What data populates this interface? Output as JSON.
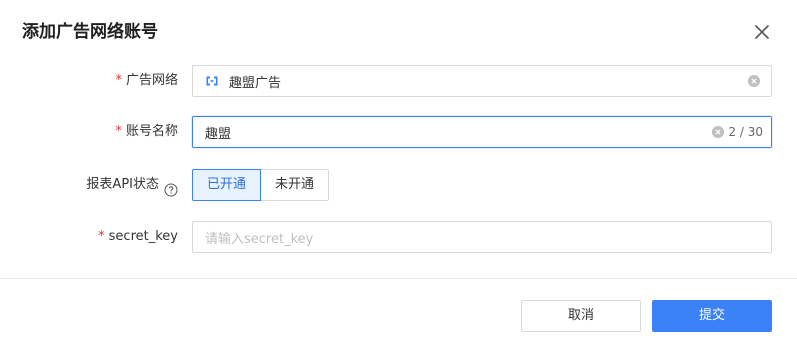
{
  "dialog": {
    "title": "添加广告网络账号"
  },
  "form": {
    "ad_network": {
      "label": "广告网络",
      "required_mark": "*",
      "value": "趣盟广告",
      "icon": "network-logo-icon"
    },
    "account_name": {
      "label": "账号名称",
      "required_mark": "*",
      "value": "趣盟",
      "counter": "2 / 30"
    },
    "report_api": {
      "label": "报表API状态",
      "options": [
        "已开通",
        "未开通"
      ],
      "selected": "已开通"
    },
    "secret_key": {
      "label": "secret_key",
      "required_mark": "*",
      "placeholder": "请输入secret_key",
      "value": ""
    }
  },
  "footer": {
    "cancel_label": "取消",
    "submit_label": "提交"
  },
  "colors": {
    "primary": "#3b82f6",
    "required": "#e5352b",
    "border": "#d9d9d9"
  }
}
